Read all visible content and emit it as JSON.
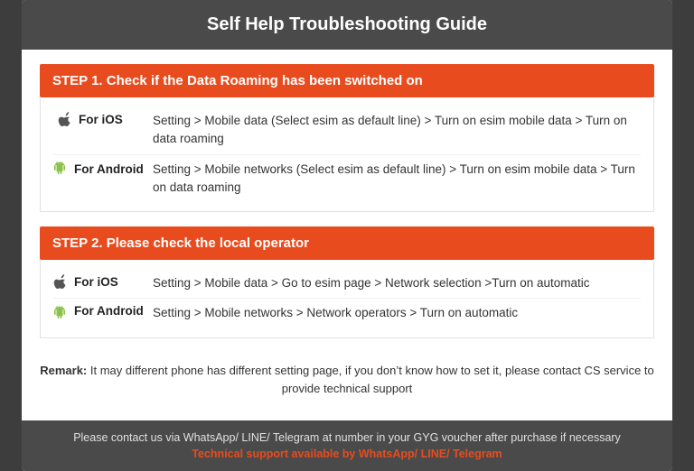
{
  "header": {
    "title": "Self Help Troubleshooting Guide",
    "bg_color": "#4a4a4a"
  },
  "step1": {
    "label": "STEP 1.  Check if the Data Roaming has been switched on",
    "ios_platform": "For iOS",
    "ios_text": "Setting > Mobile data (Select esim as default line) > Turn on esim mobile data > Turn on data roaming",
    "android_platform": "For Android",
    "android_text": "Setting > Mobile networks (Select esim as default line) > Turn on esim mobile data > Turn on data roaming"
  },
  "step2": {
    "label": "STEP 2.  Please check the local operator",
    "ios_platform": "For iOS",
    "ios_text": "Setting > Mobile data > Go to esim page > Network selection >Turn on automatic",
    "android_platform": "For Android",
    "android_text": "Setting > Mobile networks > Network operators > Turn on automatic"
  },
  "remark": {
    "prefix": "Remark:",
    "text": " It may different phone has different setting page, if you don’t know how to set it,  please contact CS service to provide technical support"
  },
  "footer": {
    "line1": "Please contact us via WhatsApp/ LINE/ Telegram at number in your GYG voucher after purchase if necessary",
    "line2": "Technical support available by WhatsApp/ LINE/ Telegram"
  },
  "icons": {
    "apple": "",
    "android": "⬧"
  }
}
